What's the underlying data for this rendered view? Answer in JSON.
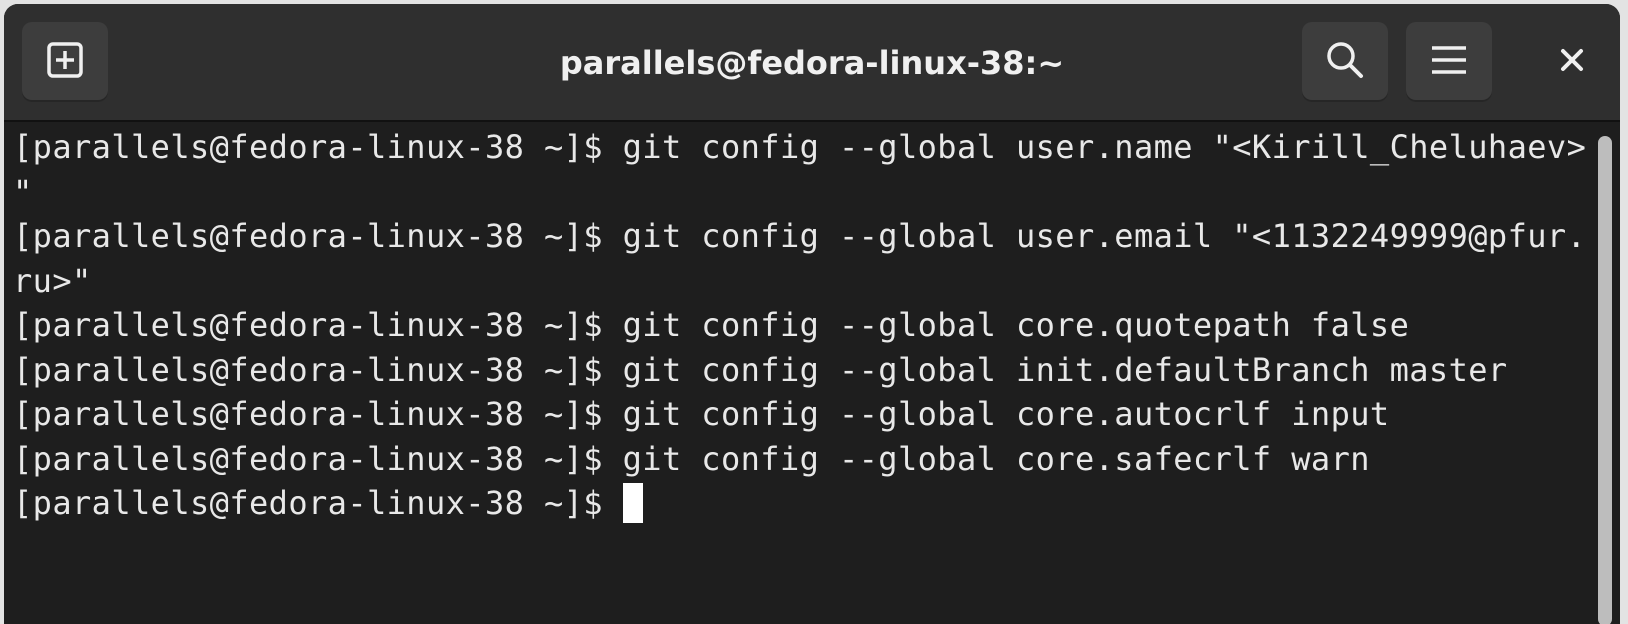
{
  "window": {
    "title": "parallels@fedora-linux-38:~"
  },
  "header": {
    "new_tab_icon": "new-tab-plus-icon",
    "search_icon": "search-icon",
    "menu_icon": "hamburger-menu-icon",
    "close_icon": "close-icon"
  },
  "terminal": {
    "lines": [
      "[parallels@fedora-linux-38 ~]$ git config --global user.name \"<Kirill_Cheluhaev>",
      "\"",
      "[parallels@fedora-linux-38 ~]$ git config --global user.email \"<1132249999@pfur.",
      "ru>\"",
      "[parallels@fedora-linux-38 ~]$ git config --global core.quotepath false",
      "[parallels@fedora-linux-38 ~]$ git config --global init.defaultBranch master",
      "[parallels@fedora-linux-38 ~]$ git config --global core.autocrlf input",
      "[parallels@fedora-linux-38 ~]$ git config --global core.safecrlf warn"
    ],
    "prompt": "[parallels@fedora-linux-38 ~]$ "
  },
  "colors": {
    "background": "#1e1e1e",
    "titlebar": "#2f2f2f",
    "text": "#e8e8e8"
  }
}
